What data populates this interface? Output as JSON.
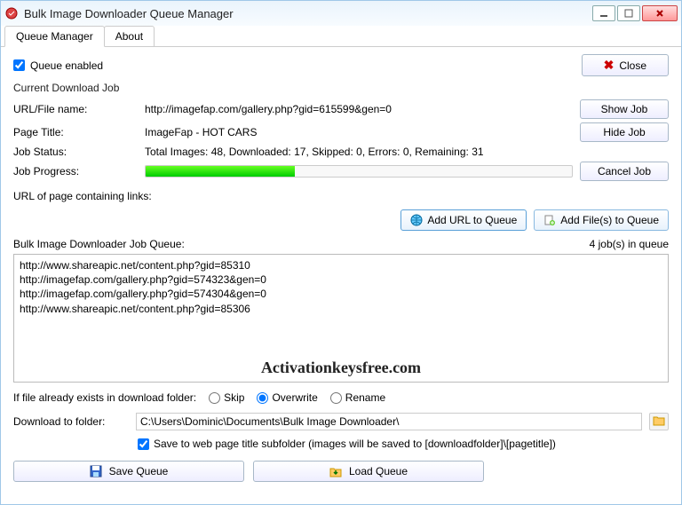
{
  "window": {
    "title": "Bulk Image Downloader Queue Manager"
  },
  "tabs": {
    "queue": "Queue Manager",
    "about": "About"
  },
  "queue_enabled_label": "Queue enabled",
  "close_label": "Close",
  "current_job_header": "Current Download Job",
  "job": {
    "url_label": "URL/File name:",
    "url_value": "http://imagefap.com/gallery.php?gid=615599&gen=0",
    "title_label": "Page Title:",
    "title_value": "ImageFap - HOT CARS",
    "status_label": "Job Status:",
    "status_value": "Total Images: 48, Downloaded: 17, Skipped: 0, Errors: 0, Remaining: 31",
    "progress_label": "Job Progress:",
    "progress_pct": 35
  },
  "job_buttons": {
    "show": "Show Job",
    "hide": "Hide Job",
    "cancel": "Cancel Job"
  },
  "url_input_label": "URL of page containing links:",
  "add_url_btn": "Add URL to Queue",
  "add_files_btn": "Add File(s) to Queue",
  "queue_label": "Bulk Image Downloader Job Queue:",
  "queue_count": "4 job(s) in queue",
  "queue_items": [
    "http://www.shareapic.net/content.php?gid=85310",
    "http://imagefap.com/gallery.php?gid=574323&gen=0",
    "http://imagefap.com/gallery.php?gid=574304&gen=0",
    "http://www.shareapic.net/content.php?gid=85306"
  ],
  "watermark": "Activationkeysfree.com",
  "exists_label": "If file already exists in download folder:",
  "exists_opts": {
    "skip": "Skip",
    "overwrite": "Overwrite",
    "rename": "Rename"
  },
  "download_to_label": "Download to folder:",
  "download_to_value": "C:\\Users\\Dominic\\Documents\\Bulk Image Downloader\\",
  "subfolder_label": "Save to web page title subfolder (images will be saved to [downloadfolder]\\[pagetitle])",
  "save_queue_btn": "Save Queue",
  "load_queue_btn": "Load Queue"
}
